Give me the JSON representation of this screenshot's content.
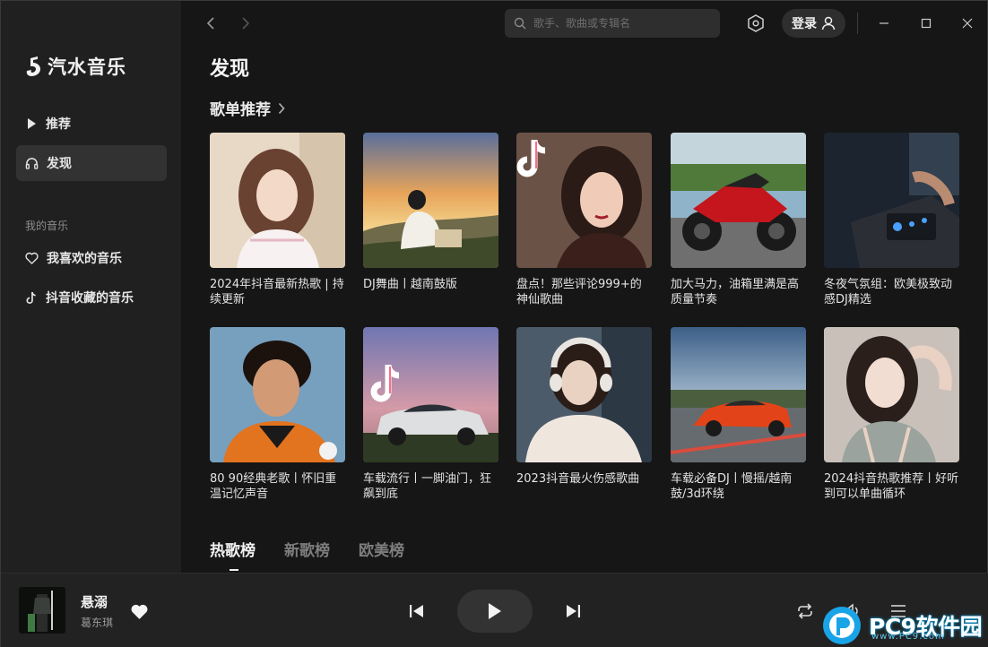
{
  "app": {
    "name": "汽水音乐"
  },
  "sidebar": {
    "items": [
      {
        "label": "推荐",
        "icon": "play-icon"
      },
      {
        "label": "发现",
        "icon": "headphones-icon"
      }
    ],
    "my_music_section": "我的音乐",
    "my_music_items": [
      {
        "label": "我喜欢的音乐",
        "icon": "heart-icon"
      },
      {
        "label": "抖音收藏的音乐",
        "icon": "tiktok-icon"
      }
    ]
  },
  "topbar": {
    "search_placeholder": "歌手、歌曲或专辑名",
    "login_label": "登录"
  },
  "main": {
    "page_title": "发现",
    "section_title": "歌单推荐",
    "playlists": [
      {
        "title": "2024年抖音最新热歌 | 持续更新"
      },
      {
        "title": "DJ舞曲丨越南鼓版"
      },
      {
        "title": "盘点！那些评论999+的神仙歌曲"
      },
      {
        "title": "加大马力，油箱里满是高质量节奏"
      },
      {
        "title": "冬夜气氛组：欧美极致动感DJ精选"
      },
      {
        "title": "80 90经典老歌丨怀旧重温记忆声音"
      },
      {
        "title": "车载流行丨一脚油门，狂飙到底"
      },
      {
        "title": "2023抖音最火伤感歌曲"
      },
      {
        "title": "车载必备DJ丨慢摇/越南鼓/3d环绕"
      },
      {
        "title": "2024抖音热歌推荐丨好听到可以单曲循环"
      }
    ],
    "chart_tabs": [
      {
        "label": "热歌榜",
        "active": true
      },
      {
        "label": "新歌榜",
        "active": false
      },
      {
        "label": "欧美榜",
        "active": false
      }
    ]
  },
  "player": {
    "song_title": "悬溺",
    "artist": "葛东琪"
  },
  "watermark": {
    "text": "PC9软件园",
    "sub": "www.PC9.com"
  },
  "colors": {
    "background": "#161616",
    "sidebar": "#202020",
    "active_item": "#323232",
    "player": "#222222"
  }
}
